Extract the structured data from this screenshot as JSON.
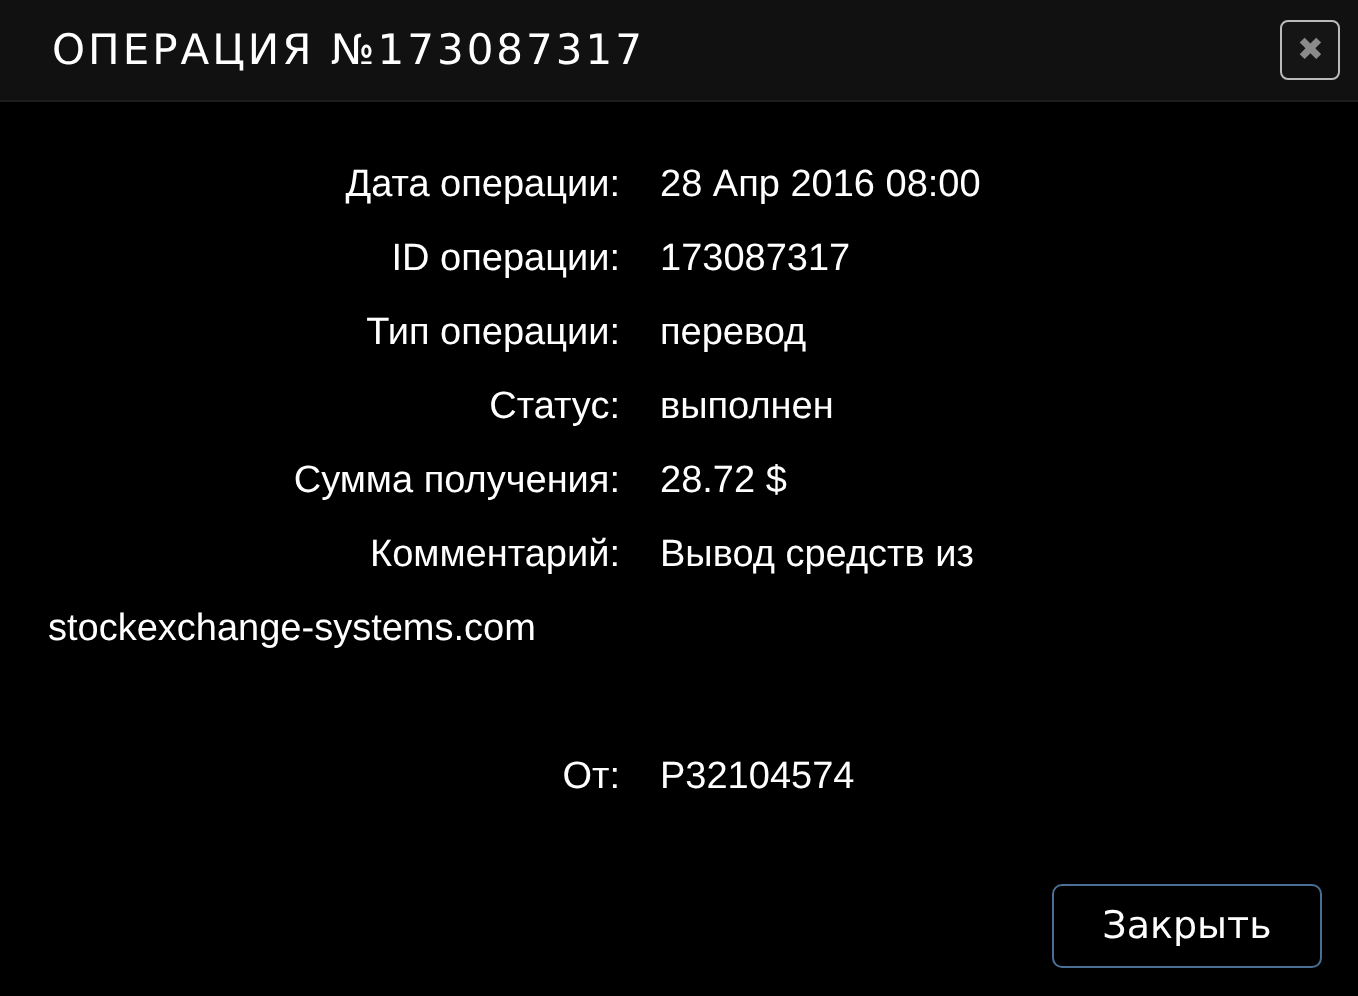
{
  "window": {
    "title": "ОПЕРАЦИЯ №173087317",
    "close": "✖"
  },
  "fields": [
    {
      "label": "Дата операции:",
      "value": "28 Апр 2016 08:00"
    },
    {
      "label": "ID операции:",
      "value": "173087317"
    },
    {
      "label": "Тип операции:",
      "value": "перевод"
    },
    {
      "label": "Статус:",
      "value": "выполнен"
    },
    {
      "label": "Сумма получения:",
      "value": "28.72 $"
    },
    {
      "label": "Комментарий:",
      "value": "Вывод средств из",
      "continuation": "stockexchange-systems.com"
    },
    {
      "label": "От:",
      "value": "P32104574"
    }
  ],
  "buttons": [
    "Закрыть"
  ]
}
